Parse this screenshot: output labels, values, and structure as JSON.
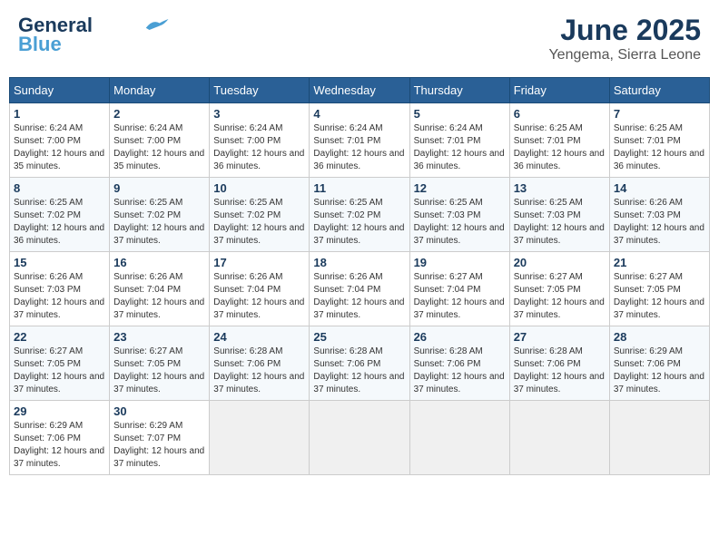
{
  "header": {
    "logo_general": "General",
    "logo_blue": "Blue",
    "month": "June 2025",
    "location": "Yengema, Sierra Leone"
  },
  "weekdays": [
    "Sunday",
    "Monday",
    "Tuesday",
    "Wednesday",
    "Thursday",
    "Friday",
    "Saturday"
  ],
  "weeks": [
    [
      {
        "day": "1",
        "sunrise": "6:24 AM",
        "sunset": "7:00 PM",
        "daylight": "12 hours and 35 minutes."
      },
      {
        "day": "2",
        "sunrise": "6:24 AM",
        "sunset": "7:00 PM",
        "daylight": "12 hours and 35 minutes."
      },
      {
        "day": "3",
        "sunrise": "6:24 AM",
        "sunset": "7:00 PM",
        "daylight": "12 hours and 36 minutes."
      },
      {
        "day": "4",
        "sunrise": "6:24 AM",
        "sunset": "7:01 PM",
        "daylight": "12 hours and 36 minutes."
      },
      {
        "day": "5",
        "sunrise": "6:24 AM",
        "sunset": "7:01 PM",
        "daylight": "12 hours and 36 minutes."
      },
      {
        "day": "6",
        "sunrise": "6:25 AM",
        "sunset": "7:01 PM",
        "daylight": "12 hours and 36 minutes."
      },
      {
        "day": "7",
        "sunrise": "6:25 AM",
        "sunset": "7:01 PM",
        "daylight": "12 hours and 36 minutes."
      }
    ],
    [
      {
        "day": "8",
        "sunrise": "6:25 AM",
        "sunset": "7:02 PM",
        "daylight": "12 hours and 36 minutes."
      },
      {
        "day": "9",
        "sunrise": "6:25 AM",
        "sunset": "7:02 PM",
        "daylight": "12 hours and 37 minutes."
      },
      {
        "day": "10",
        "sunrise": "6:25 AM",
        "sunset": "7:02 PM",
        "daylight": "12 hours and 37 minutes."
      },
      {
        "day": "11",
        "sunrise": "6:25 AM",
        "sunset": "7:02 PM",
        "daylight": "12 hours and 37 minutes."
      },
      {
        "day": "12",
        "sunrise": "6:25 AM",
        "sunset": "7:03 PM",
        "daylight": "12 hours and 37 minutes."
      },
      {
        "day": "13",
        "sunrise": "6:25 AM",
        "sunset": "7:03 PM",
        "daylight": "12 hours and 37 minutes."
      },
      {
        "day": "14",
        "sunrise": "6:26 AM",
        "sunset": "7:03 PM",
        "daylight": "12 hours and 37 minutes."
      }
    ],
    [
      {
        "day": "15",
        "sunrise": "6:26 AM",
        "sunset": "7:03 PM",
        "daylight": "12 hours and 37 minutes."
      },
      {
        "day": "16",
        "sunrise": "6:26 AM",
        "sunset": "7:04 PM",
        "daylight": "12 hours and 37 minutes."
      },
      {
        "day": "17",
        "sunrise": "6:26 AM",
        "sunset": "7:04 PM",
        "daylight": "12 hours and 37 minutes."
      },
      {
        "day": "18",
        "sunrise": "6:26 AM",
        "sunset": "7:04 PM",
        "daylight": "12 hours and 37 minutes."
      },
      {
        "day": "19",
        "sunrise": "6:27 AM",
        "sunset": "7:04 PM",
        "daylight": "12 hours and 37 minutes."
      },
      {
        "day": "20",
        "sunrise": "6:27 AM",
        "sunset": "7:05 PM",
        "daylight": "12 hours and 37 minutes."
      },
      {
        "day": "21",
        "sunrise": "6:27 AM",
        "sunset": "7:05 PM",
        "daylight": "12 hours and 37 minutes."
      }
    ],
    [
      {
        "day": "22",
        "sunrise": "6:27 AM",
        "sunset": "7:05 PM",
        "daylight": "12 hours and 37 minutes."
      },
      {
        "day": "23",
        "sunrise": "6:27 AM",
        "sunset": "7:05 PM",
        "daylight": "12 hours and 37 minutes."
      },
      {
        "day": "24",
        "sunrise": "6:28 AM",
        "sunset": "7:06 PM",
        "daylight": "12 hours and 37 minutes."
      },
      {
        "day": "25",
        "sunrise": "6:28 AM",
        "sunset": "7:06 PM",
        "daylight": "12 hours and 37 minutes."
      },
      {
        "day": "26",
        "sunrise": "6:28 AM",
        "sunset": "7:06 PM",
        "daylight": "12 hours and 37 minutes."
      },
      {
        "day": "27",
        "sunrise": "6:28 AM",
        "sunset": "7:06 PM",
        "daylight": "12 hours and 37 minutes."
      },
      {
        "day": "28",
        "sunrise": "6:29 AM",
        "sunset": "7:06 PM",
        "daylight": "12 hours and 37 minutes."
      }
    ],
    [
      {
        "day": "29",
        "sunrise": "6:29 AM",
        "sunset": "7:06 PM",
        "daylight": "12 hours and 37 minutes."
      },
      {
        "day": "30",
        "sunrise": "6:29 AM",
        "sunset": "7:07 PM",
        "daylight": "12 hours and 37 minutes."
      },
      null,
      null,
      null,
      null,
      null
    ]
  ]
}
